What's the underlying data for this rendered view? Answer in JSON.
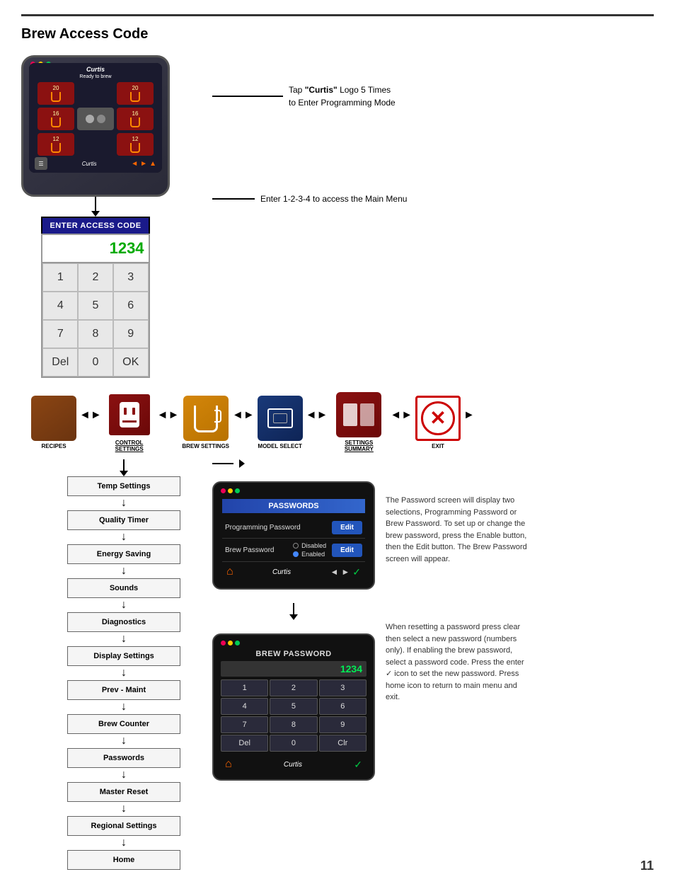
{
  "page": {
    "title": "Brew Access Code",
    "page_number": "11"
  },
  "device": {
    "top_dots": [
      "red",
      "yellow",
      "green"
    ],
    "logo": "Curtis",
    "ready_label": "Ready to brew",
    "brew_buttons": [
      "20",
      "20",
      "16",
      "16",
      "12",
      "12"
    ],
    "nav_arrows": [
      "◄",
      "►",
      "▲"
    ]
  },
  "keypad": {
    "title": "ENTER ACCESS CODE",
    "display_value": "1234",
    "keys": [
      "1",
      "2",
      "3",
      "4",
      "5",
      "6",
      "7",
      "8",
      "9",
      "Del",
      "0",
      "OK"
    ]
  },
  "annotations": {
    "tap_label": "Tap ",
    "tap_bold": "\"Curtis\"",
    "tap_rest": " Logo 5 Times",
    "tap_line2": "to Enter Programming Mode",
    "enter_label": "Enter 1-2-3-4 to access the Main Menu"
  },
  "icons": {
    "recipes": {
      "label": "RECIPES"
    },
    "control_settings": {
      "label": "CONTROL SETTINGS"
    },
    "brew_settings": {
      "label": "BREW SETTINGS"
    },
    "model_select": {
      "label": "MODEL SELECT"
    },
    "settings_summary": {
      "label": "SETTINGS SUMMARY"
    },
    "exit": {
      "label": "EXIT"
    }
  },
  "control_menu": {
    "items": [
      "Temp Settings",
      "Quality Timer",
      "Energy Saving",
      "Sounds",
      "Diagnostics",
      "Display Settings",
      "Prev - Maint",
      "Brew Counter",
      "Passwords",
      "Master Reset",
      "Regional Settings",
      "Home"
    ]
  },
  "passwords_screen": {
    "title": "PASSWORDS",
    "prog_password_label": "Programming Password",
    "prog_edit_label": "Edit",
    "brew_password_label": "Brew Password",
    "brew_disabled": "Disabled",
    "brew_enabled": "Enabled",
    "brew_edit_label": "Edit"
  },
  "brew_password_screen": {
    "title": "BREW PASSWORD",
    "display_value": "1234",
    "keys": [
      "1",
      "2",
      "3",
      "4",
      "5",
      "6",
      "7",
      "8",
      "9",
      "Del",
      "0",
      "Clr"
    ]
  },
  "description_pw": "The Password screen will display two selections, Programming Password or Brew Password. To set up or change the brew password, press the Enable button, then the Edit button. The Brew Password screen will appear.",
  "description_brew_pw": "When resetting a password press clear then select a new password (numbers only). If enabling the brew password, select a password code. Press the enter ✓ icon to set the new password. Press home icon to return to main menu and exit."
}
